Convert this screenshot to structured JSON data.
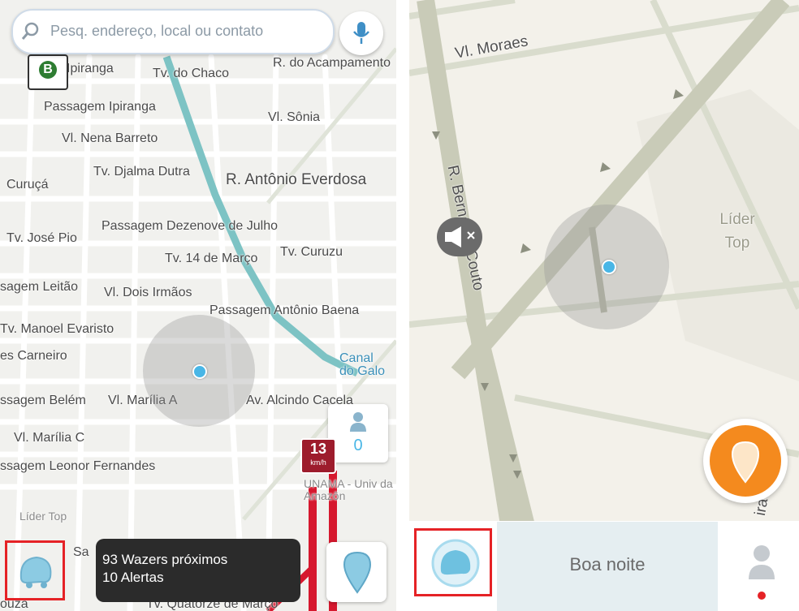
{
  "left_screen": {
    "search": {
      "placeholder": "Pesq. endereço, local ou contato",
      "icon": "search-icon"
    },
    "mic_icon": "microphone-icon",
    "map_pin": {
      "letter": "B"
    },
    "street_labels": [
      "Ipiranga",
      "Tv. do Chaco",
      "R. do Acampamento",
      "Passagem Ipiranga",
      "Vl. Sônia",
      "Vl. Nena Barreto",
      "Tv. Djalma Dutra",
      "R. Antônio Everdosa",
      "Curuçá",
      "Passagem Dezenove de Julho",
      "Tv. José Pio",
      "Tv. Curuzu",
      "Tv. 14 de Março",
      "sagem Leitão",
      "Vl. Dois Irmãos",
      "Passagem Antônio Baena",
      "Tv. Manoel Evaristo",
      "es Carneiro",
      "Canal do Galo",
      "ssagem Belém",
      "Vl. Marília A",
      "Av. Alcindo Cacela",
      "Vl. Marília C",
      "ssagem Leonor Fernandes",
      "UNAMA - Univ da Amazôn",
      "Líder Top",
      "Sa",
      "ouza",
      "Tv. Quatorze de Março"
    ],
    "nearby_users": {
      "count": "0",
      "icon": "person-icon"
    },
    "speed": {
      "value": "13",
      "unit": "km/h"
    },
    "info": {
      "wazers": "93 Wazers próximos",
      "alerts": "10 Alertas"
    },
    "menu_icon": "waze-menu-icon",
    "report_icon": "report-pin-icon",
    "colors": {
      "canal": "#7dc3c4",
      "traffic": "#d6182e",
      "location": "#49b6e6"
    }
  },
  "right_screen": {
    "street_labels": [
      "Vl. Moraes",
      "R. Berna do Couto",
      "Líder Top",
      "ira"
    ],
    "mute_icon": "speaker-muted-icon",
    "greeting": "Boa noite",
    "menu_icon": "waze-menu-icon",
    "report_icon": "report-orange-icon",
    "profile_icon": "person-icon",
    "colors": {
      "main_road": "#c9cbb8",
      "accent": "#f48a1e",
      "highlight": "#e52226"
    }
  }
}
